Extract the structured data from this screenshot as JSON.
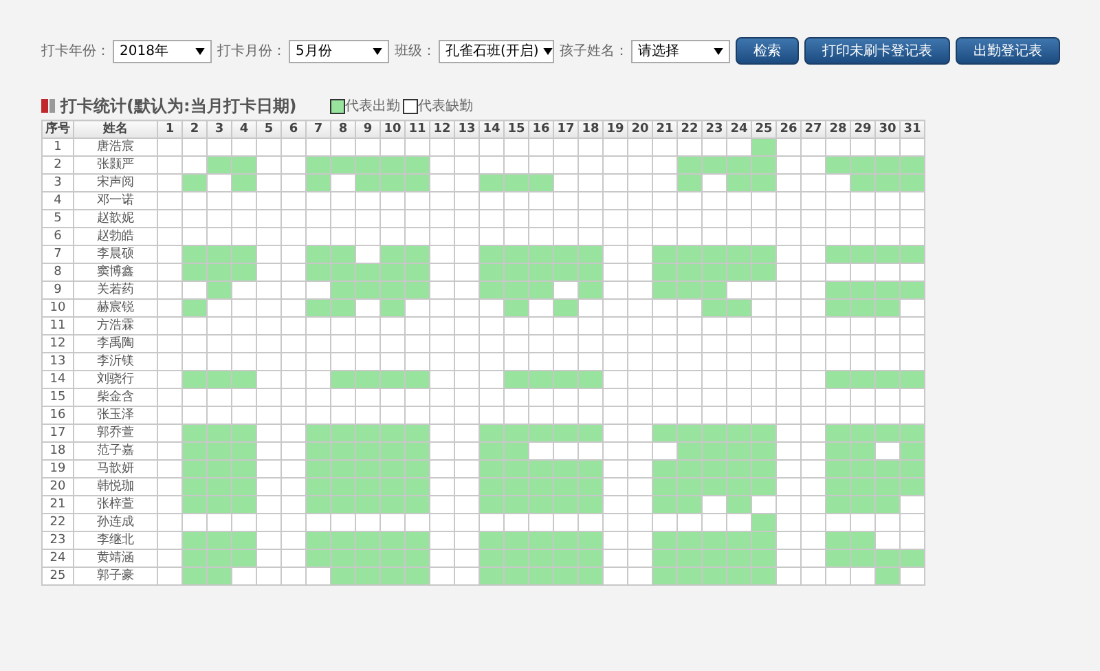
{
  "filters": [
    {
      "label": "打卡年份：",
      "value": "2018年"
    },
    {
      "label": "打卡月份：",
      "value": "5月份"
    },
    {
      "label": "班级：",
      "value": "孔雀石班(开启)"
    },
    {
      "label": "孩子姓名：",
      "value": "请选择"
    }
  ],
  "buttons": [
    "检索",
    "打印未刷卡登记表",
    "出勤登记表"
  ],
  "section_title": "打卡统计(默认为:当月打卡日期)",
  "legend": [
    {
      "label": "代表出勤",
      "present": true
    },
    {
      "label": "代表缺勤",
      "present": false
    }
  ],
  "table": {
    "columns": [
      "序号",
      "姓名"
    ],
    "days": [
      "1",
      "2",
      "3",
      "4",
      "5",
      "6",
      "7",
      "8",
      "9",
      "10",
      "11",
      "12",
      "13",
      "14",
      "15",
      "16",
      "17",
      "18",
      "19",
      "20",
      "21",
      "22",
      "23",
      "24",
      "25",
      "26",
      "27",
      "28",
      "29",
      "30",
      "31"
    ],
    "rows": [
      {
        "no": "1",
        "name": "唐浩宸",
        "present": [
          false,
          false,
          false,
          false,
          false,
          false,
          false,
          false,
          false,
          false,
          false,
          false,
          false,
          false,
          false,
          false,
          false,
          false,
          false,
          false,
          false,
          false,
          false,
          false,
          true,
          false,
          false,
          false,
          false,
          false,
          false
        ]
      },
      {
        "no": "2",
        "name": "张颢严",
        "present": [
          false,
          false,
          true,
          true,
          false,
          false,
          true,
          true,
          true,
          true,
          true,
          false,
          false,
          false,
          false,
          false,
          false,
          false,
          false,
          false,
          false,
          true,
          true,
          true,
          true,
          false,
          false,
          true,
          true,
          true,
          true
        ]
      },
      {
        "no": "3",
        "name": "宋声阅",
        "present": [
          false,
          true,
          false,
          true,
          false,
          false,
          true,
          false,
          true,
          true,
          true,
          false,
          false,
          true,
          true,
          true,
          false,
          false,
          false,
          false,
          false,
          true,
          false,
          true,
          true,
          false,
          false,
          false,
          true,
          true,
          true
        ]
      },
      {
        "no": "4",
        "name": "邓一诺",
        "present": [
          false,
          false,
          false,
          false,
          false,
          false,
          false,
          false,
          false,
          false,
          false,
          false,
          false,
          false,
          false,
          false,
          false,
          false,
          false,
          false,
          false,
          false,
          false,
          false,
          false,
          false,
          false,
          false,
          false,
          false,
          false
        ]
      },
      {
        "no": "5",
        "name": "赵歆妮",
        "present": [
          false,
          false,
          false,
          false,
          false,
          false,
          false,
          false,
          false,
          false,
          false,
          false,
          false,
          false,
          false,
          false,
          false,
          false,
          false,
          false,
          false,
          false,
          false,
          false,
          false,
          false,
          false,
          false,
          false,
          false,
          false
        ]
      },
      {
        "no": "6",
        "name": "赵勃皓",
        "present": [
          false,
          false,
          false,
          false,
          false,
          false,
          false,
          false,
          false,
          false,
          false,
          false,
          false,
          false,
          false,
          false,
          false,
          false,
          false,
          false,
          false,
          false,
          false,
          false,
          false,
          false,
          false,
          false,
          false,
          false,
          false
        ]
      },
      {
        "no": "7",
        "name": "李晨硕",
        "present": [
          false,
          true,
          true,
          true,
          false,
          false,
          true,
          true,
          false,
          true,
          true,
          false,
          false,
          true,
          true,
          true,
          true,
          true,
          false,
          false,
          true,
          true,
          true,
          true,
          true,
          false,
          false,
          true,
          true,
          true,
          true
        ]
      },
      {
        "no": "8",
        "name": "窦博鑫",
        "present": [
          false,
          true,
          true,
          true,
          false,
          false,
          true,
          true,
          true,
          true,
          true,
          false,
          false,
          true,
          true,
          true,
          true,
          true,
          false,
          false,
          true,
          true,
          true,
          true,
          true,
          false,
          false,
          false,
          false,
          false,
          false
        ]
      },
      {
        "no": "9",
        "name": "关若药",
        "present": [
          false,
          false,
          true,
          false,
          false,
          false,
          false,
          true,
          true,
          true,
          true,
          false,
          false,
          true,
          true,
          true,
          false,
          true,
          false,
          false,
          true,
          true,
          true,
          false,
          false,
          false,
          false,
          true,
          true,
          true,
          true
        ]
      },
      {
        "no": "10",
        "name": "赫宸锐",
        "present": [
          false,
          true,
          false,
          false,
          false,
          false,
          true,
          true,
          false,
          true,
          false,
          false,
          false,
          false,
          true,
          false,
          true,
          false,
          false,
          false,
          false,
          false,
          true,
          true,
          false,
          false,
          false,
          true,
          true,
          true,
          false
        ]
      },
      {
        "no": "11",
        "name": "方浩霖",
        "present": [
          false,
          false,
          false,
          false,
          false,
          false,
          false,
          false,
          false,
          false,
          false,
          false,
          false,
          false,
          false,
          false,
          false,
          false,
          false,
          false,
          false,
          false,
          false,
          false,
          false,
          false,
          false,
          false,
          false,
          false,
          false
        ]
      },
      {
        "no": "12",
        "name": "李禹陶",
        "present": [
          false,
          false,
          false,
          false,
          false,
          false,
          false,
          false,
          false,
          false,
          false,
          false,
          false,
          false,
          false,
          false,
          false,
          false,
          false,
          false,
          false,
          false,
          false,
          false,
          false,
          false,
          false,
          false,
          false,
          false,
          false
        ]
      },
      {
        "no": "13",
        "name": "李沂镁",
        "present": [
          false,
          false,
          false,
          false,
          false,
          false,
          false,
          false,
          false,
          false,
          false,
          false,
          false,
          false,
          false,
          false,
          false,
          false,
          false,
          false,
          false,
          false,
          false,
          false,
          false,
          false,
          false,
          false,
          false,
          false,
          false
        ]
      },
      {
        "no": "14",
        "name": "刘骁行",
        "present": [
          false,
          true,
          true,
          true,
          false,
          false,
          false,
          true,
          true,
          true,
          true,
          false,
          false,
          false,
          true,
          true,
          true,
          true,
          false,
          false,
          false,
          false,
          false,
          false,
          false,
          false,
          false,
          true,
          true,
          true,
          true
        ]
      },
      {
        "no": "15",
        "name": "柴金含",
        "present": [
          false,
          false,
          false,
          false,
          false,
          false,
          false,
          false,
          false,
          false,
          false,
          false,
          false,
          false,
          false,
          false,
          false,
          false,
          false,
          false,
          false,
          false,
          false,
          false,
          false,
          false,
          false,
          false,
          false,
          false,
          false
        ]
      },
      {
        "no": "16",
        "name": "张玉泽",
        "present": [
          false,
          false,
          false,
          false,
          false,
          false,
          false,
          false,
          false,
          false,
          false,
          false,
          false,
          false,
          false,
          false,
          false,
          false,
          false,
          false,
          false,
          false,
          false,
          false,
          false,
          false,
          false,
          false,
          false,
          false,
          false
        ]
      },
      {
        "no": "17",
        "name": "郭乔萱",
        "present": [
          false,
          true,
          true,
          true,
          false,
          false,
          true,
          true,
          true,
          true,
          true,
          false,
          false,
          true,
          true,
          true,
          true,
          true,
          false,
          false,
          true,
          true,
          true,
          true,
          true,
          false,
          false,
          true,
          true,
          true,
          true
        ]
      },
      {
        "no": "18",
        "name": "范子嘉",
        "present": [
          false,
          true,
          true,
          true,
          false,
          false,
          true,
          true,
          true,
          true,
          true,
          false,
          false,
          true,
          true,
          false,
          false,
          false,
          false,
          false,
          false,
          true,
          true,
          true,
          true,
          false,
          false,
          true,
          true,
          false,
          true
        ]
      },
      {
        "no": "19",
        "name": "马歆妍",
        "present": [
          false,
          true,
          true,
          true,
          false,
          false,
          true,
          true,
          true,
          true,
          true,
          false,
          false,
          true,
          true,
          true,
          true,
          true,
          false,
          false,
          true,
          true,
          true,
          true,
          true,
          false,
          false,
          true,
          true,
          true,
          true
        ]
      },
      {
        "no": "20",
        "name": "韩悦珈",
        "present": [
          false,
          true,
          true,
          true,
          false,
          false,
          true,
          true,
          true,
          true,
          true,
          false,
          false,
          true,
          true,
          true,
          true,
          true,
          false,
          false,
          true,
          true,
          true,
          true,
          true,
          false,
          false,
          true,
          true,
          true,
          true
        ]
      },
      {
        "no": "21",
        "name": "张梓萱",
        "present": [
          false,
          true,
          true,
          true,
          false,
          false,
          true,
          true,
          true,
          true,
          true,
          false,
          false,
          true,
          true,
          true,
          true,
          true,
          false,
          false,
          true,
          true,
          false,
          true,
          false,
          false,
          false,
          true,
          true,
          true,
          false
        ]
      },
      {
        "no": "22",
        "name": "孙连成",
        "present": [
          false,
          false,
          false,
          false,
          false,
          false,
          false,
          false,
          false,
          false,
          false,
          false,
          false,
          false,
          false,
          false,
          false,
          false,
          false,
          false,
          false,
          false,
          false,
          false,
          true,
          false,
          false,
          false,
          false,
          false,
          false
        ]
      },
      {
        "no": "23",
        "name": "李继北",
        "present": [
          false,
          true,
          true,
          true,
          false,
          false,
          true,
          true,
          true,
          true,
          true,
          false,
          false,
          true,
          true,
          true,
          true,
          true,
          false,
          false,
          true,
          true,
          true,
          true,
          true,
          false,
          false,
          true,
          true,
          false,
          false
        ]
      },
      {
        "no": "24",
        "name": "黄靖涵",
        "present": [
          false,
          true,
          true,
          true,
          false,
          false,
          true,
          true,
          true,
          true,
          true,
          false,
          false,
          true,
          true,
          true,
          true,
          true,
          false,
          false,
          true,
          true,
          true,
          true,
          true,
          false,
          false,
          true,
          true,
          true,
          true
        ]
      },
      {
        "no": "25",
        "name": "郭子豪",
        "present": [
          false,
          true,
          true,
          false,
          false,
          false,
          false,
          true,
          true,
          true,
          true,
          false,
          false,
          true,
          true,
          true,
          true,
          true,
          false,
          false,
          true,
          true,
          true,
          true,
          true,
          false,
          false,
          false,
          false,
          true,
          false
        ]
      }
    ]
  }
}
